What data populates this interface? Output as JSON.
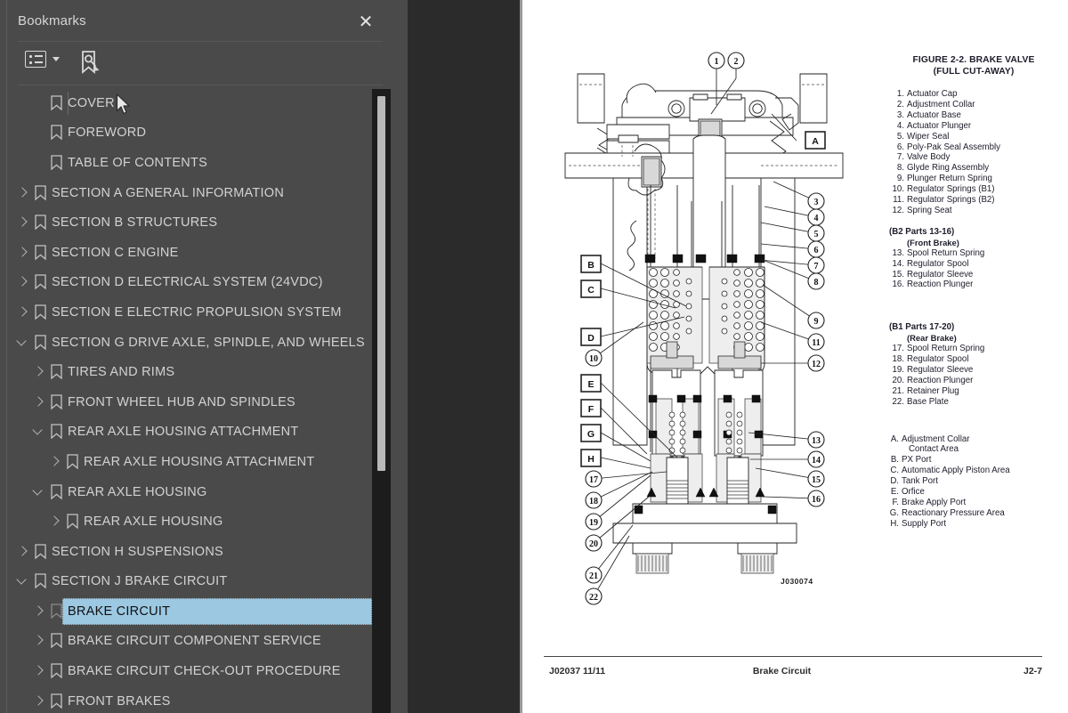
{
  "panel": {
    "title": "Bookmarks",
    "close_label": "✕",
    "toolbar": {
      "options_icon": "list-options-icon",
      "find_bookmark_icon": "find-bookmark-icon",
      "cursor_icon": "mouse-cursor-icon"
    },
    "tree": [
      {
        "label": "COVER",
        "indent": 0,
        "twisty": "none"
      },
      {
        "label": "FOREWORD",
        "indent": 0,
        "twisty": "none"
      },
      {
        "label": "TABLE OF CONTENTS",
        "indent": 0,
        "twisty": "none"
      },
      {
        "label": "SECTION A GENERAL INFORMATION",
        "indent": 1,
        "twisty": "collapsed"
      },
      {
        "label": "SECTION B STRUCTURES",
        "indent": 1,
        "twisty": "collapsed"
      },
      {
        "label": "SECTION C ENGINE",
        "indent": 1,
        "twisty": "collapsed"
      },
      {
        "label": "SECTION D ELECTRICAL SYSTEM (24VDC)",
        "indent": 1,
        "twisty": "collapsed"
      },
      {
        "label": "SECTION E ELECTRIC PROPULSION SYSTEM",
        "indent": 1,
        "twisty": "collapsed"
      },
      {
        "label": "SECTION G DRIVE AXLE, SPINDLE, AND WHEELS",
        "indent": 1,
        "twisty": "expanded"
      },
      {
        "label": "TIRES AND RIMS",
        "indent": 2,
        "twisty": "collapsed"
      },
      {
        "label": "FRONT WHEEL HUB AND SPINDLES",
        "indent": 2,
        "twisty": "collapsed"
      },
      {
        "label": "REAR AXLE HOUSING ATTACHMENT",
        "indent": 2,
        "twisty": "expanded"
      },
      {
        "label": "REAR AXLE HOUSING ATTACHMENT",
        "indent": 3,
        "twisty": "collapsed"
      },
      {
        "label": "REAR AXLE HOUSING",
        "indent": 2,
        "twisty": "expanded"
      },
      {
        "label": "REAR AXLE HOUSING",
        "indent": 3,
        "twisty": "collapsed"
      },
      {
        "label": "SECTION H SUSPENSIONS",
        "indent": 1,
        "twisty": "collapsed"
      },
      {
        "label": "SECTION J BRAKE CIRCUIT",
        "indent": 1,
        "twisty": "expanded"
      },
      {
        "label": "BRAKE CIRCUIT",
        "indent": 2,
        "twisty": "collapsed",
        "selected": true
      },
      {
        "label": "BRAKE CIRCUIT COMPONENT SERVICE",
        "indent": 2,
        "twisty": "collapsed"
      },
      {
        "label": "BRAKE CIRCUIT CHECK-OUT PROCEDURE",
        "indent": 2,
        "twisty": "collapsed"
      },
      {
        "label": "FRONT BRAKES",
        "indent": 2,
        "twisty": "collapsed"
      }
    ],
    "selection_color": "#9cc8e2",
    "panel_bg": "#4a4a4a"
  },
  "viewer": {
    "collapse_handle": "collapse-sidebar-arrow",
    "page": {
      "figure": {
        "title_line1": "FIGURE 2-2. BRAKE VALVE",
        "title_line2": "(FULL CUT-AWAY)",
        "drawing_number": "J030074",
        "numbered_parts": [
          {
            "n": "1.",
            "label": "Actuator Cap"
          },
          {
            "n": "2.",
            "label": "Adjustment Collar"
          },
          {
            "n": "3.",
            "label": "Actuator Base"
          },
          {
            "n": "4.",
            "label": "Actuator Plunger"
          },
          {
            "n": "5.",
            "label": "Wiper Seal"
          },
          {
            "n": "6.",
            "label": "Poly-Pak Seal Assembly"
          },
          {
            "n": "7.",
            "label": "Valve Body"
          },
          {
            "n": "8.",
            "label": "Glyde Ring Assembly"
          },
          {
            "n": "9.",
            "label": "Plunger Return Spring"
          },
          {
            "n": "10.",
            "label": "Regulator Springs (B1)"
          },
          {
            "n": "11.",
            "label": "Regulator Springs (B2)"
          },
          {
            "n": "12.",
            "label": "Spring Seat"
          }
        ],
        "group_b2": {
          "heading": "(B2 Parts 13-16)",
          "subheading": "(Front Brake)",
          "parts": [
            {
              "n": "13.",
              "label": "Spool Return Spring"
            },
            {
              "n": "14.",
              "label": "Regulator Spool"
            },
            {
              "n": "15.",
              "label": "Regulator Sleeve"
            },
            {
              "n": "16.",
              "label": "Reaction Plunger"
            }
          ]
        },
        "group_b1": {
          "heading": "(B1 Parts 17-20)",
          "subheading": "(Rear Brake)",
          "parts": [
            {
              "n": "17.",
              "label": "Spool Return Spring"
            },
            {
              "n": "18.",
              "label": "Regulator Spool"
            },
            {
              "n": "19.",
              "label": "Regulator Sleeve"
            },
            {
              "n": "20.",
              "label": "Reaction Plunger"
            },
            {
              "n": "21.",
              "label": "Retainer Plug"
            },
            {
              "n": "22.",
              "label": "Base Plate"
            }
          ]
        },
        "lettered_parts": [
          {
            "n": "A.",
            "label": "Adjustment Collar",
            "cont": "Contact Area"
          },
          {
            "n": "B.",
            "label": "PX Port"
          },
          {
            "n": "C.",
            "label": "Automatic Apply Piston Area"
          },
          {
            "n": "D.",
            "label": "Tank Port"
          },
          {
            "n": "E.",
            "label": "Orfice"
          },
          {
            "n": "F.",
            "label": "Brake Apply Port"
          },
          {
            "n": "G.",
            "label": "Reactionary Pressure Area"
          },
          {
            "n": "H.",
            "label": "Supply Port"
          }
        ],
        "callouts_left_letters": [
          "B",
          "C",
          "D",
          "E",
          "F",
          "G",
          "H"
        ],
        "callouts_left_numbers": [
          "10",
          "17",
          "18",
          "19",
          "20",
          "21",
          "22"
        ],
        "callouts_right_letters": [
          "A"
        ],
        "callouts_right_numbers": [
          "3",
          "4",
          "5",
          "6",
          "7",
          "8",
          "9",
          "11",
          "12",
          "13",
          "14",
          "15",
          "16"
        ],
        "callouts_top_numbers": [
          "1",
          "2"
        ]
      },
      "footer": {
        "left": "J02037  11/11",
        "center": "Brake Circuit",
        "right": "J2-7"
      }
    }
  }
}
